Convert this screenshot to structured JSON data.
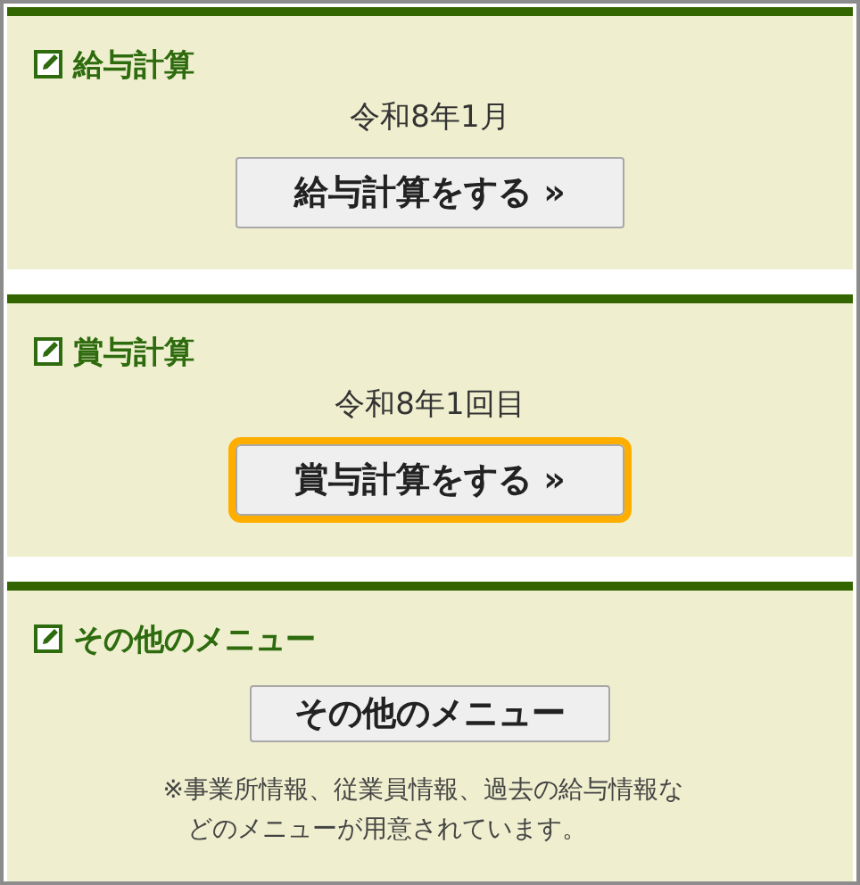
{
  "sections": [
    {
      "title": "給与計算",
      "subtitle": "令和8年1月",
      "button": {
        "kind": "primary",
        "label": "給与計算をする »",
        "highlighted": false
      }
    },
    {
      "title": "賞与計算",
      "subtitle": "令和8年1回目",
      "button": {
        "kind": "primary",
        "label": "賞与計算をする »",
        "highlighted": true
      }
    },
    {
      "title": "その他のメニュー",
      "button": {
        "kind": "secondary",
        "label": "その他のメニュー",
        "highlighted": false
      },
      "note": "※事業所情報、従業員情報、過去の給与情報などのメニューが用意されています。"
    }
  ]
}
